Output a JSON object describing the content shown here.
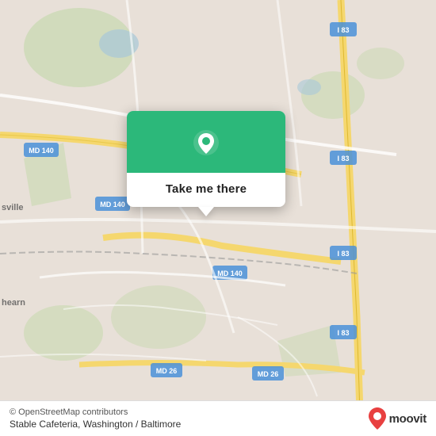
{
  "map": {
    "background_color": "#e8e0d8",
    "center_lat": 39.35,
    "center_lon": -76.68
  },
  "popup": {
    "button_label": "Take me there",
    "pin_color": "#ffffff",
    "background_color": "#2cb87a"
  },
  "bottom_bar": {
    "attribution": "© OpenStreetMap contributors",
    "location_name": "Stable Cafeteria, Washington / Baltimore",
    "logo_text": "moovit"
  },
  "road_labels": [
    {
      "label": "MD 140",
      "positions": [
        "top-left",
        "mid-left",
        "mid-center"
      ]
    },
    {
      "label": "MD 26",
      "positions": [
        "bottom-center",
        "bottom-left"
      ]
    },
    {
      "label": "I 83",
      "positions": [
        "top-right",
        "mid-right",
        "bottom-right"
      ]
    },
    {
      "label": "sville",
      "position": "left"
    },
    {
      "label": "hearn",
      "position": "lower-left"
    }
  ],
  "colors": {
    "accent_green": "#2cb87a",
    "road_yellow": "#f5d76e",
    "road_white": "#ffffff",
    "map_bg": "#e8e0d8",
    "map_green_area": "#c8d8b0",
    "text_dark": "#222222",
    "attribution_color": "#555555"
  }
}
